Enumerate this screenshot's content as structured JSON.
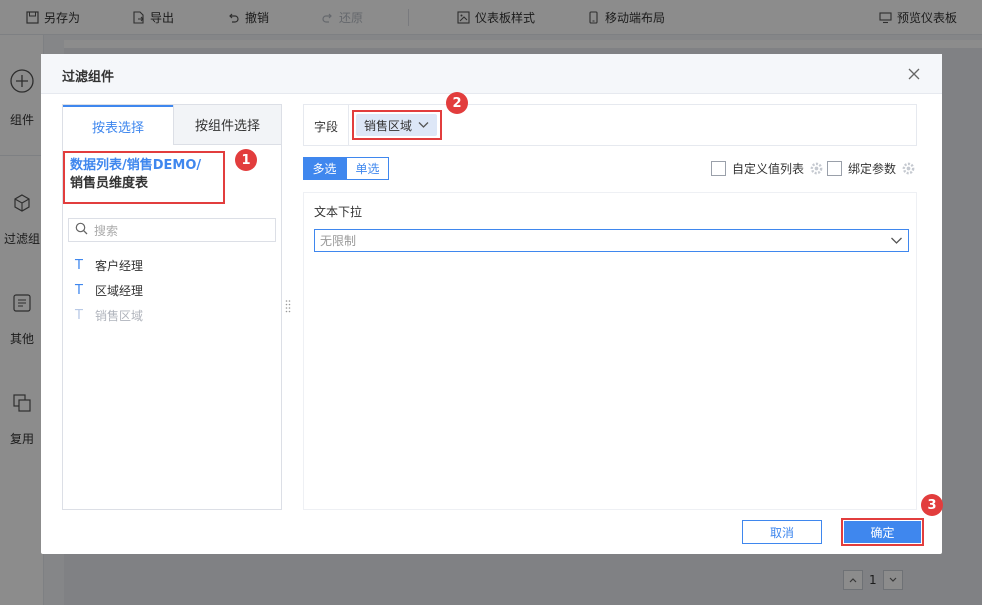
{
  "toolbar": {
    "save_as": "另存为",
    "export": "导出",
    "undo": "撤销",
    "redo": "还原",
    "dashboard_style": "仪表板样式",
    "mobile_layout": "移动端布局",
    "preview": "预览仪表板"
  },
  "rail": {
    "component": "组件",
    "filter": "过滤组",
    "other": "其他",
    "reuse": "复用"
  },
  "dialog": {
    "title": "过滤组件",
    "tabs": {
      "by_table": "按表选择",
      "by_component": "按组件选择"
    },
    "path_line1": "数据列表/销售DEMO/",
    "path_line2": "销售员维度表",
    "search_placeholder": "搜索",
    "fields": [
      {
        "label": "客户经理",
        "disabled": false
      },
      {
        "label": "区域经理",
        "disabled": false
      },
      {
        "label": "销售区域",
        "disabled": true
      }
    ],
    "field_label": "字段",
    "field_value": "销售区域",
    "mode_multi": "多选",
    "mode_single": "单选",
    "custom_value_list": "自定义值列表",
    "bind_param": "绑定参数",
    "control_title": "文本下拉",
    "control_value": "无限制",
    "cancel": "取消",
    "confirm": "确定"
  },
  "badges": [
    "1",
    "2",
    "3"
  ],
  "pager": {
    "page": "1"
  },
  "colors": {
    "accent": "#3f87ee",
    "highlight": "#e23d3d"
  }
}
